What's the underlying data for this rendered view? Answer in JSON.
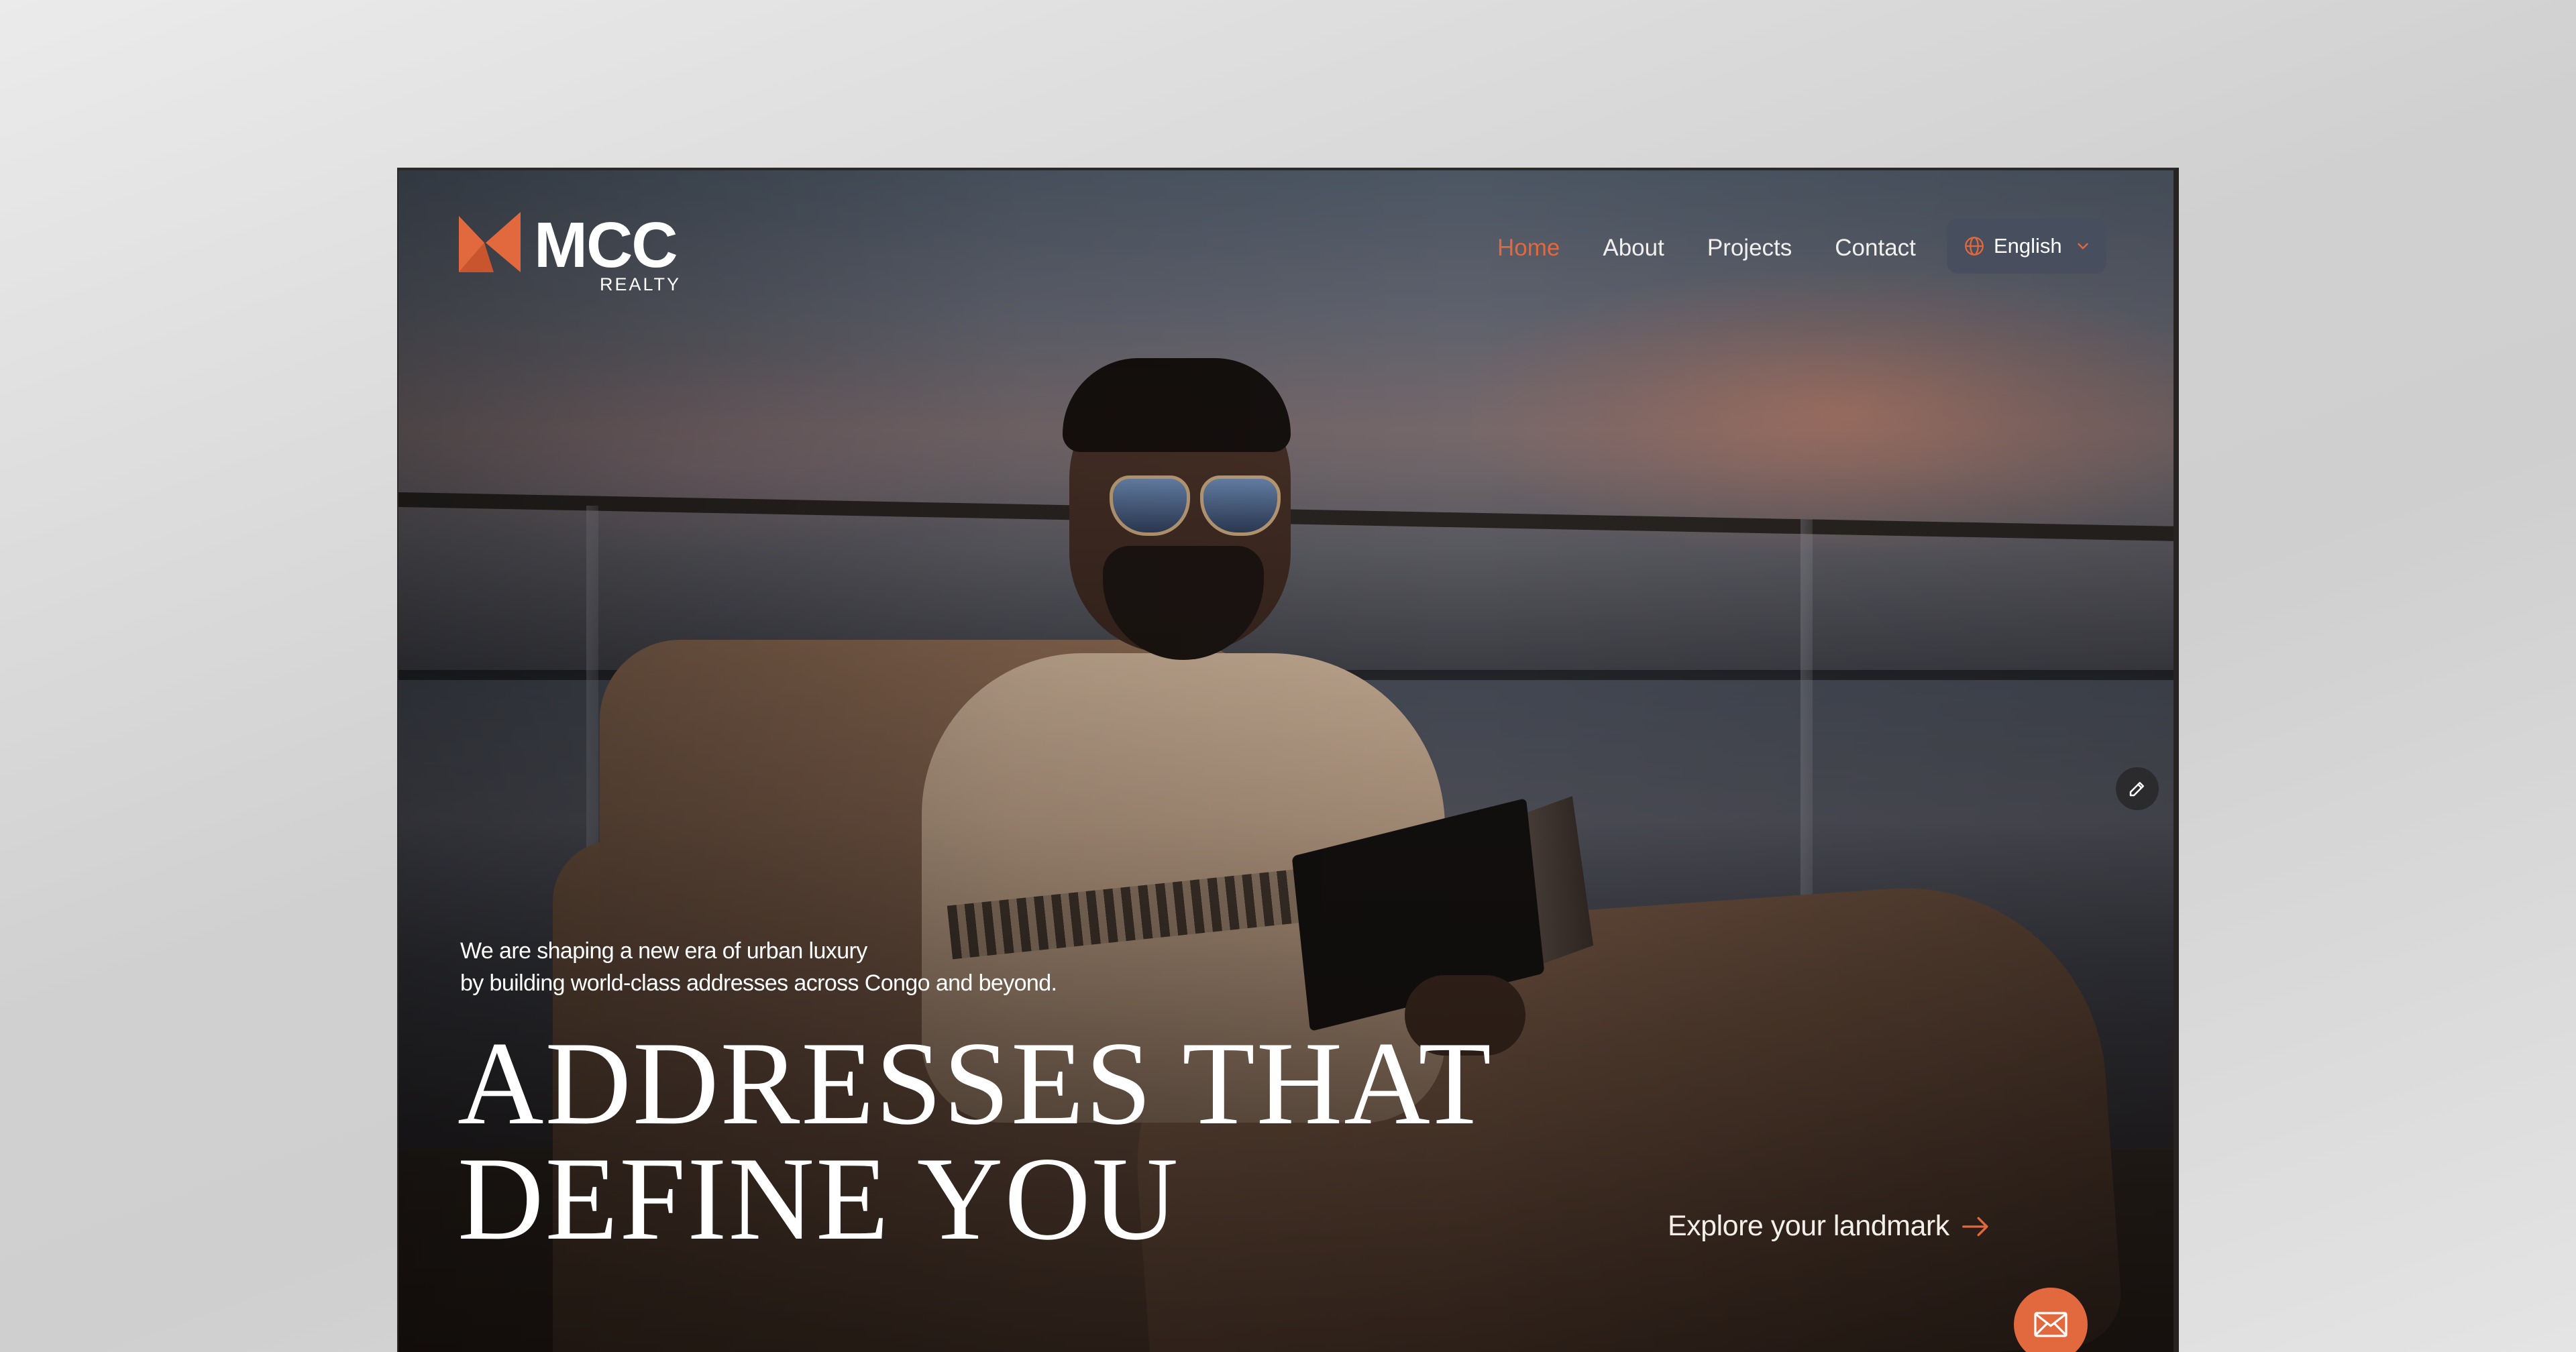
{
  "brand": {
    "name": "MCC",
    "sub": "REALTY",
    "accent_color": "#e2693e"
  },
  "nav": {
    "items": [
      {
        "label": "Home",
        "active": true
      },
      {
        "label": "About",
        "active": false
      },
      {
        "label": "Projects",
        "active": false
      },
      {
        "label": "Contact",
        "active": false
      }
    ]
  },
  "language": {
    "selected": "English",
    "icon": "globe-icon"
  },
  "hero": {
    "tagline_line1": "We are shaping a new era of urban luxury",
    "tagline_line2": "by building world-class addresses across Congo and beyond.",
    "headline_line1": "ADDRESSES THAT",
    "headline_line2": "DEFINE YOU",
    "cta_label": "Explore your landmark",
    "cta_icon": "arrow-right-icon"
  },
  "actions": {
    "edit_icon": "pencil-icon",
    "mail_icon": "mail-icon"
  }
}
